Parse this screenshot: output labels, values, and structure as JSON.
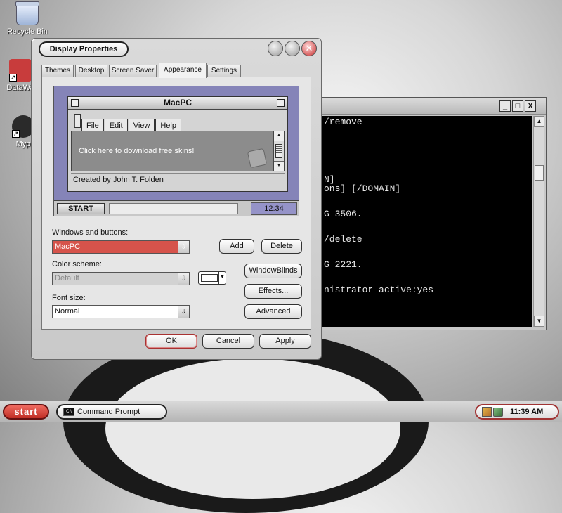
{
  "desktop": {
    "icons": [
      {
        "label": "Recycle Bin"
      },
      {
        "label": "DataWa"
      },
      {
        "label": "Myp"
      }
    ]
  },
  "cmd_window": {
    "lines": [
      "/remove",
      "N]",
      "ons] [/DOMAIN]",
      "G 3506.",
      "/delete",
      "G 2221.",
      "nistrator active:yes"
    ],
    "controls": {
      "minimize": "_",
      "maximize": "□",
      "close": "X"
    }
  },
  "dialog": {
    "title": "Display Properties",
    "close_glyph": "✕",
    "tabs": [
      "Themes",
      "Desktop",
      "Screen Saver",
      "Appearance",
      "Settings"
    ],
    "active_tab": "Appearance",
    "preview": {
      "window_title": "MacPC",
      "menu": [
        "File",
        "Edit",
        "View",
        "Help"
      ],
      "content_text": "Click here to download free skins!",
      "status_text": "Created by John T. Folden",
      "start_label": "START",
      "clock": "12:34"
    },
    "windows_buttons": {
      "label": "Windows and buttons:",
      "value": "MacPC"
    },
    "color_scheme": {
      "label": "Color scheme:",
      "value": "Default"
    },
    "font_size": {
      "label": "Font size:",
      "value": "Normal"
    },
    "buttons": {
      "add": "Add",
      "delete": "Delete",
      "windowblinds": "WindowBlinds",
      "effects": "Effects...",
      "advanced": "Advanced",
      "ok": "OK",
      "cancel": "Cancel",
      "apply": "Apply"
    }
  },
  "taskbar": {
    "start_label": "start",
    "task_label": "Command Prompt",
    "cmd_icon_text": "C:\\",
    "clock": "11:39 AM"
  },
  "colors": {
    "start_button": "#d6453c",
    "selected_skin": "#d6534b",
    "preview_bg": "#8584b8"
  }
}
